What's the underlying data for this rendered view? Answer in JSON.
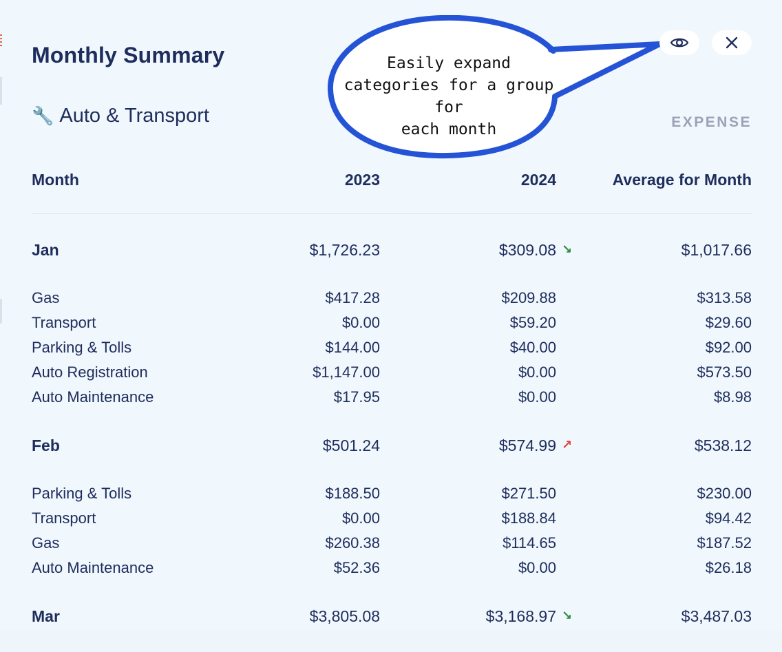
{
  "header": {
    "title": "Monthly Summary",
    "group_icon": "wrench-icon",
    "group_glyph": "🔧",
    "group_name": "Auto & Transport",
    "type_label": "EXPENSE"
  },
  "actions": {
    "expand_icon": "eye-icon",
    "close_icon": "close-icon"
  },
  "callout": {
    "line1": "Easily expand",
    "line2": "categories for a group for",
    "line3": "each month"
  },
  "table": {
    "headers": {
      "month": "Month",
      "year1": "2023",
      "year2": "2024",
      "average": "Average for Month"
    },
    "months": [
      {
        "name": "Jan",
        "y1": "$1,726.23",
        "y2": "$309.08",
        "trend": "down",
        "trend_glyph": "↘",
        "avg": "$1,017.66",
        "categories": [
          {
            "name": "Gas",
            "y1": "$417.28",
            "y2": "$209.88",
            "avg": "$313.58"
          },
          {
            "name": "Transport",
            "y1": "$0.00",
            "y2": "$59.20",
            "avg": "$29.60"
          },
          {
            "name": "Parking & Tolls",
            "y1": "$144.00",
            "y2": "$40.00",
            "avg": "$92.00"
          },
          {
            "name": "Auto Registration",
            "y1": "$1,147.00",
            "y2": "$0.00",
            "avg": "$573.50"
          },
          {
            "name": "Auto Maintenance",
            "y1": "$17.95",
            "y2": "$0.00",
            "avg": "$8.98"
          }
        ]
      },
      {
        "name": "Feb",
        "y1": "$501.24",
        "y2": "$574.99",
        "trend": "up",
        "trend_glyph": "↗",
        "avg": "$538.12",
        "categories": [
          {
            "name": "Parking & Tolls",
            "y1": "$188.50",
            "y2": "$271.50",
            "avg": "$230.00"
          },
          {
            "name": "Transport",
            "y1": "$0.00",
            "y2": "$188.84",
            "avg": "$94.42"
          },
          {
            "name": "Gas",
            "y1": "$260.38",
            "y2": "$114.65",
            "avg": "$187.52"
          },
          {
            "name": "Auto Maintenance",
            "y1": "$52.36",
            "y2": "$0.00",
            "avg": "$26.18"
          }
        ]
      },
      {
        "name": "Mar",
        "y1": "$3,805.08",
        "y2": "$3,168.97",
        "trend": "down",
        "trend_glyph": "↘",
        "avg": "$3,487.03",
        "categories": []
      }
    ]
  },
  "colors": {
    "text": "#1e2d5c",
    "muted": "#9aa3b8",
    "background": "#f0f7fd",
    "trend_down": "#2e8b3a",
    "trend_up": "#e0413a",
    "callout_border": "#2453d6"
  }
}
